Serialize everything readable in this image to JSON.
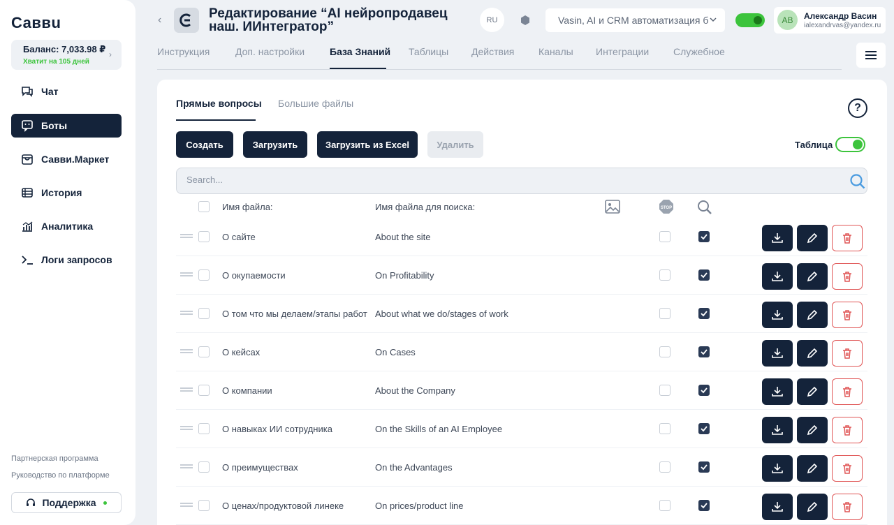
{
  "sidebar": {
    "logo": "Саввu",
    "balance": "Баланс: 7,033.98 ₽",
    "balance_note": "Хватит на 105 дней",
    "items": [
      {
        "label": "Чат",
        "icon": "chat-icon"
      },
      {
        "label": "Боты",
        "icon": "bot-icon",
        "active": true
      },
      {
        "label": "Савви.Маркет",
        "icon": "market-icon"
      },
      {
        "label": "История",
        "icon": "history-icon"
      },
      {
        "label": "Аналитика",
        "icon": "analytics-icon"
      },
      {
        "label": "Логи запросов",
        "icon": "terminal-icon"
      }
    ],
    "partner_link": "Партнерская программа",
    "guide_link": "Руководство по платформе",
    "support": "Поддержка"
  },
  "header": {
    "back": "‹",
    "title": "Редактирование “AI нейропродавец наш. ИИнтегратор”",
    "lang": "RU",
    "select_value": "Vasin, AI и CRM автоматизация б",
    "user_initials": "АВ",
    "user_name": "Александр Васин",
    "user_email": "ialexandrvas@yandex.ru"
  },
  "tabs": [
    "Инструкция",
    "Доп. настройки",
    "База Знаний",
    "Таблицы",
    "Действия",
    "Каналы",
    "Интеграции",
    "Служебное"
  ],
  "active_tab": "База Знаний",
  "subtabs": [
    "Прямые вопросы",
    "Большие файлы"
  ],
  "help": "?",
  "buttons": {
    "create": "Создать",
    "upload": "Загрузить",
    "upload_excel": "Загрузить из Excel",
    "delete": "Удалить"
  },
  "table_toggle_label": "Таблица",
  "search_placeholder": "Search...",
  "columns": {
    "file_name": "Имя файла:",
    "search_name": "Имя файла для поиска:"
  },
  "rows": [
    {
      "name": "О сайте",
      "search": "About the site"
    },
    {
      "name": "О окупаемости",
      "search": "On Profitability"
    },
    {
      "name": "О том что мы делаем/этапы работ",
      "search": "About what we do/stages of work"
    },
    {
      "name": "О кейсах",
      "search": "On Cases"
    },
    {
      "name": "О компании",
      "search": "About the Company"
    },
    {
      "name": "О навыках ИИ сотрудника",
      "search": "On the Skills of an AI Employee"
    },
    {
      "name": "О преимуществах",
      "search": "On the Advantages"
    },
    {
      "name": "О ценах/продуктовой линеке",
      "search": "On prices/product line"
    }
  ],
  "colors": {
    "accent": "#14233a",
    "green": "#3cc43c",
    "danger": "#e05656"
  }
}
